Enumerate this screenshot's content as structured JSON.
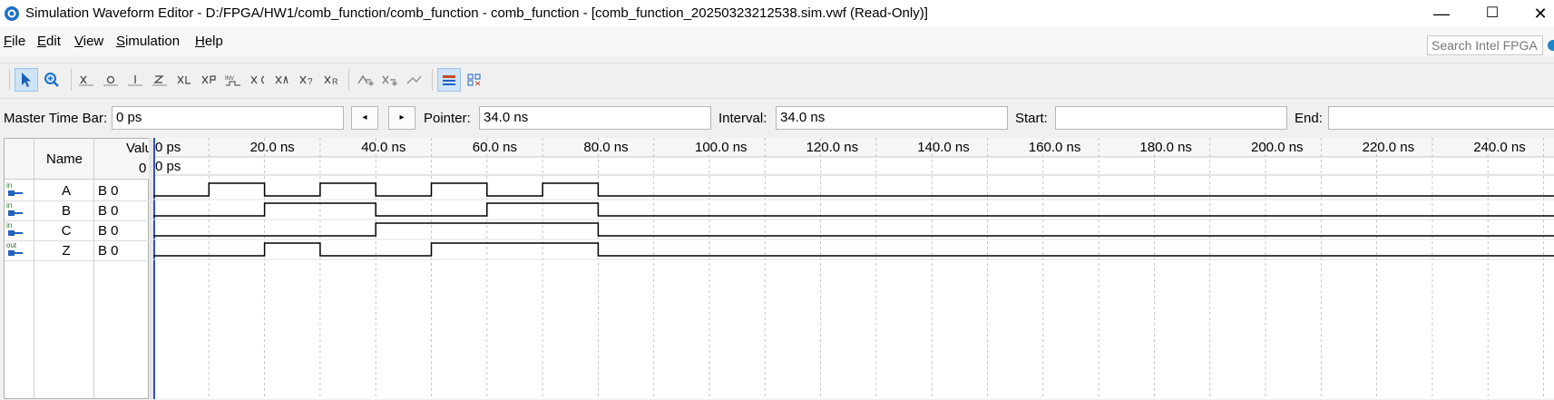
{
  "window": {
    "title": "Simulation Waveform Editor - D:/FPGA/HW1/comb_function/comb_function - comb_function - [comb_function_20250323212538.sim.vwf (Read-Only)]",
    "controls": {
      "minimize": "—",
      "maximize": "☐",
      "close": "✕"
    }
  },
  "menu": [
    {
      "underline": "F",
      "rest": "ile"
    },
    {
      "underline": "E",
      "rest": "dit"
    },
    {
      "underline": "V",
      "rest": "iew"
    },
    {
      "underline": "S",
      "rest": "imulation"
    },
    {
      "underline": "H",
      "rest": "elp"
    }
  ],
  "search": {
    "placeholder": "Search Intel FPGA"
  },
  "toolbar": {
    "tools": [
      "selection-tool-icon",
      "zoom-tool-icon"
    ],
    "value_tools": [
      "forcing-unknown-icon",
      "forcing-low-icon",
      "forcing-high-icon",
      "high-impedance-icon",
      "weak-unknown-icon",
      "weak-low-icon",
      "invert-icon",
      "count-value-icon",
      "overwrite-clock-icon",
      "random-values-icon",
      "arbitrary-value-icon"
    ],
    "sim_tools": [
      "run-functional-simulation-icon",
      "run-timing-simulation-icon",
      "generate-netlist-icon"
    ],
    "view_tools": [
      "snap-to-grid-icon",
      "grid-settings-icon"
    ]
  },
  "timebar": {
    "master_label": "Master Time Bar:",
    "master_value": "0 ps",
    "prev_arrow": "◂",
    "next_arrow": "▸",
    "pointer_label": "Pointer:",
    "pointer_value": "34.0 ns",
    "interval_label": "Interval:",
    "interval_value": "34.0 ns",
    "start_label": "Start:",
    "start_value": "",
    "end_label": "End:",
    "end_value": ""
  },
  "signal_list": {
    "name_header": "Name",
    "value_header": "Valu",
    "value_time": "0",
    "rows": [
      {
        "type": "in",
        "name": "A",
        "value": "B 0"
      },
      {
        "type": "in",
        "name": "B",
        "value": "B 0"
      },
      {
        "type": "in",
        "name": "C",
        "value": "B 0"
      },
      {
        "type": "out",
        "name": "Z",
        "value": "B 0"
      }
    ]
  },
  "waveform": {
    "time_unit": "ns",
    "range_ns": [
      0,
      250
    ],
    "tick_labels": [
      "0 ps",
      "20.0 ns",
      "40.0 ns",
      "60.0 ns",
      "80.0 ns",
      "100.0 ns",
      "120.0 ns",
      "140.0 ns",
      "160.0 ns",
      "180.0 ns",
      "200.0 ns",
      "220.0 ns",
      "240.0 ns"
    ],
    "tick_values_ns": [
      0,
      20,
      40,
      60,
      80,
      100,
      120,
      140,
      160,
      180,
      200,
      220,
      240
    ],
    "grid_step_ns": 10,
    "cursor_label": "0 ps",
    "cursor_ns": 0,
    "signals": [
      {
        "name": "A",
        "transitions": [
          [
            0,
            0
          ],
          [
            10,
            1
          ],
          [
            20,
            0
          ],
          [
            30,
            1
          ],
          [
            40,
            0
          ],
          [
            50,
            1
          ],
          [
            60,
            0
          ],
          [
            70,
            1
          ],
          [
            80,
            0
          ]
        ]
      },
      {
        "name": "B",
        "transitions": [
          [
            0,
            0
          ],
          [
            20,
            1
          ],
          [
            40,
            0
          ],
          [
            60,
            1
          ],
          [
            80,
            0
          ]
        ]
      },
      {
        "name": "C",
        "transitions": [
          [
            0,
            0
          ],
          [
            40,
            1
          ],
          [
            80,
            0
          ]
        ]
      },
      {
        "name": "Z",
        "transitions": [
          [
            0,
            0
          ],
          [
            20,
            1
          ],
          [
            30,
            0
          ],
          [
            50,
            1
          ],
          [
            80,
            0
          ]
        ]
      }
    ],
    "colors": {
      "grid": "#b8b8b8",
      "wave": "#000000",
      "cursor": "#3050d0"
    }
  }
}
